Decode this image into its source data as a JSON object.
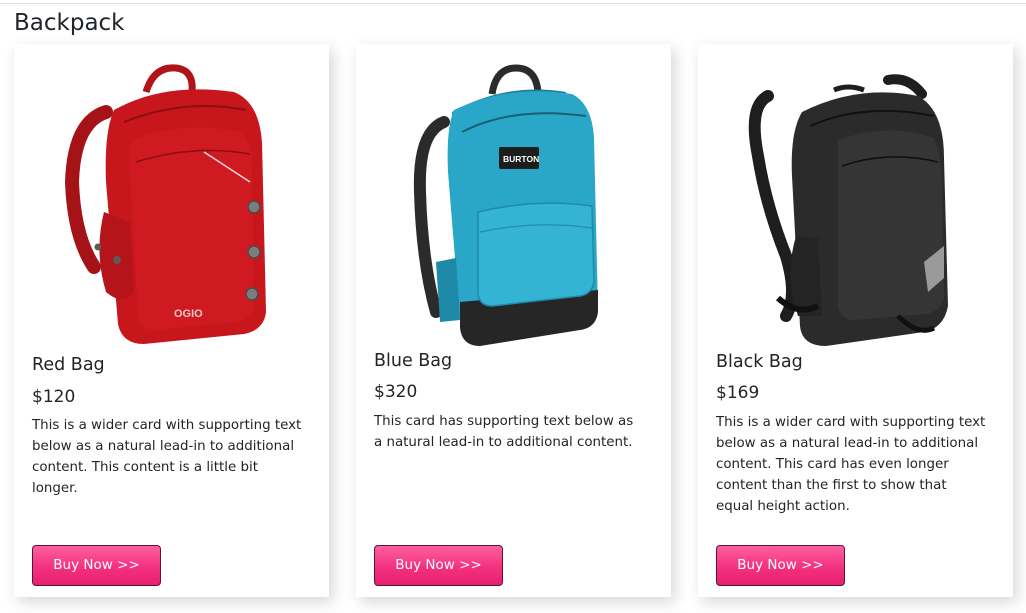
{
  "page": {
    "title": "Backpack"
  },
  "cards": [
    {
      "image_name": "red-backpack",
      "title": "Red Bag",
      "price": "$120",
      "text": "This is a wider card with supporting text below as a natural lead-in to additional content. This content is a little bit longer.",
      "button_label": "Buy Now >>",
      "color": "#c8161d",
      "image_brand": "OGIO"
    },
    {
      "image_name": "blue-backpack",
      "title": "Blue Bag",
      "price": "$320",
      "text": "This card has supporting text below as a natural lead-in to additional content.",
      "button_label": "Buy Now >>",
      "color": "#2aa6c8",
      "image_brand": "BURTON"
    },
    {
      "image_name": "black-backpack",
      "title": "Black Bag",
      "price": "$169",
      "text": "This is a wider card with supporting text below as a natural lead-in to additional content. This card has even longer content than the first to show that equal height action.",
      "button_label": "Buy Now >>",
      "color": "#2b2b2b"
    }
  ],
  "theme": {
    "button_gradient_top": "#ff5fa2",
    "button_gradient_bottom": "#e81f70",
    "text_color": "#212529"
  }
}
